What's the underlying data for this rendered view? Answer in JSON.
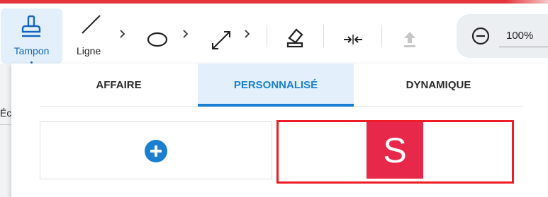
{
  "toolbar": {
    "tools": [
      {
        "label": "Tampon",
        "icon": "stamp-icon",
        "active": true
      },
      {
        "label": "Ligne",
        "icon": "line-icon"
      },
      {
        "label": "",
        "icon": "ellipse-icon"
      },
      {
        "label": "",
        "icon": "double-arrow-icon"
      },
      {
        "label": "",
        "icon": "eraser-icon"
      },
      {
        "label": "",
        "icon": "collapse-arrows-icon"
      },
      {
        "label": "",
        "icon": "upload-icon",
        "disabled": true
      }
    ],
    "zoom": {
      "value": "100%",
      "icon": "zoom-out-icon"
    }
  },
  "background_text": {
    "left_edge": "Éc"
  },
  "panel": {
    "tabs": [
      {
        "label": "AFFAIRE",
        "active": false
      },
      {
        "label": "PERSONNALISÉ",
        "active": true
      },
      {
        "label": "DYNAMIQUE",
        "active": false
      }
    ],
    "stamps": [
      {
        "type": "add",
        "icon": "add-circle-icon"
      },
      {
        "type": "stamp",
        "letter": "S",
        "color": "#e8284a",
        "selected": true
      }
    ]
  },
  "colors": {
    "accent": "#1a7fd1",
    "top_bar": "#e4353b",
    "selection": "#ee1c24",
    "stamp": "#e8284a"
  }
}
